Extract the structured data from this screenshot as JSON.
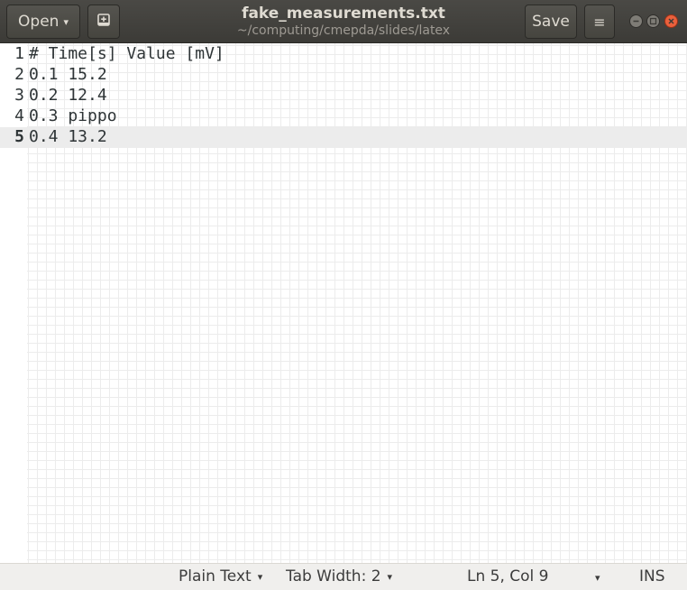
{
  "header": {
    "open_label": "Open",
    "open_caret": "▾",
    "save_label": "Save",
    "menu_glyph": "≡",
    "title": "fake_measurements.txt",
    "subtitle": "~/computing/cmepda/slides/latex",
    "icons": [
      "new-tab-icon",
      "hamburger-menu-icon",
      "minimize-icon",
      "maximize-icon",
      "close-icon"
    ],
    "close_color": "#e9603c"
  },
  "editor": {
    "current_line": 5,
    "lines": [
      {
        "number": "1",
        "text": "# Time[s] Value [mV]"
      },
      {
        "number": "2",
        "text": "0.1 15.2"
      },
      {
        "number": "3",
        "text": "0.2 12.4"
      },
      {
        "number": "4",
        "text": "0.3 pippo"
      },
      {
        "number": "5",
        "text": "0.4 13.2"
      }
    ]
  },
  "statusbar": {
    "language": "Plain Text",
    "tab_width": "Tab Width: 2",
    "position": "Ln 5, Col 9",
    "mode": "INS",
    "caret": "▾"
  }
}
